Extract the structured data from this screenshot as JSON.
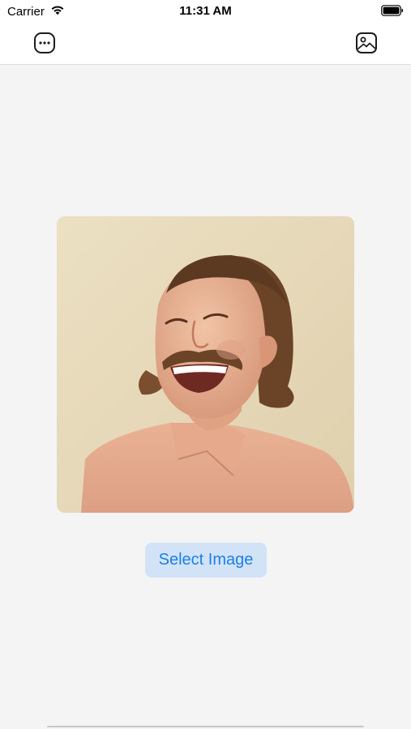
{
  "status_bar": {
    "carrier": "Carrier",
    "time": "11:31 AM"
  },
  "nav_bar": {
    "left_icon": "more-icon",
    "right_icon": "photo-icon"
  },
  "preview": {
    "image_subject": "portrait-photo"
  },
  "select_button": {
    "label": "Select Image"
  },
  "colors": {
    "accent": "#1a80e8",
    "button_bg": "#d3e3f7",
    "background": "#f4f4f5"
  }
}
